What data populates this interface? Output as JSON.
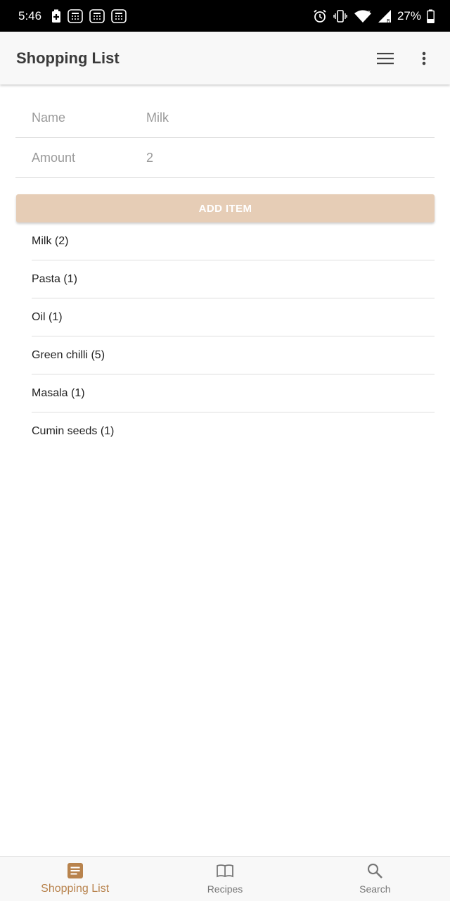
{
  "status_bar": {
    "time": "5:46",
    "battery_percent": "27%",
    "icons_left": [
      "battery-saver-icon",
      "calculator-icon",
      "calculator-icon",
      "calculator-icon"
    ],
    "icons_right": [
      "alarm-icon",
      "vibrate-icon",
      "wifi-icon",
      "signal-icon",
      "battery-icon"
    ]
  },
  "app_bar": {
    "title": "Shopping List",
    "menu_icon": "hamburger-menu-icon",
    "overflow_icon": "more-vert-icon"
  },
  "form": {
    "name_label": "Name",
    "name_value": "Milk",
    "amount_label": "Amount",
    "amount_value": "2",
    "add_button_label": "ADD ITEM"
  },
  "items": [
    "Milk (2)",
    "Pasta (1)",
    "Oil (1)",
    "Green chilli (5)",
    "Masala (1)",
    "Cumin seeds (1)"
  ],
  "bottom_nav": {
    "tabs": [
      {
        "label": "Shopping List",
        "icon": "list-icon",
        "active": true
      },
      {
        "label": "Recipes",
        "icon": "book-icon",
        "active": false
      },
      {
        "label": "Search",
        "icon": "search-icon",
        "active": false
      }
    ]
  },
  "colors": {
    "accent": "#b8834d",
    "button": "#e6cdb6"
  }
}
